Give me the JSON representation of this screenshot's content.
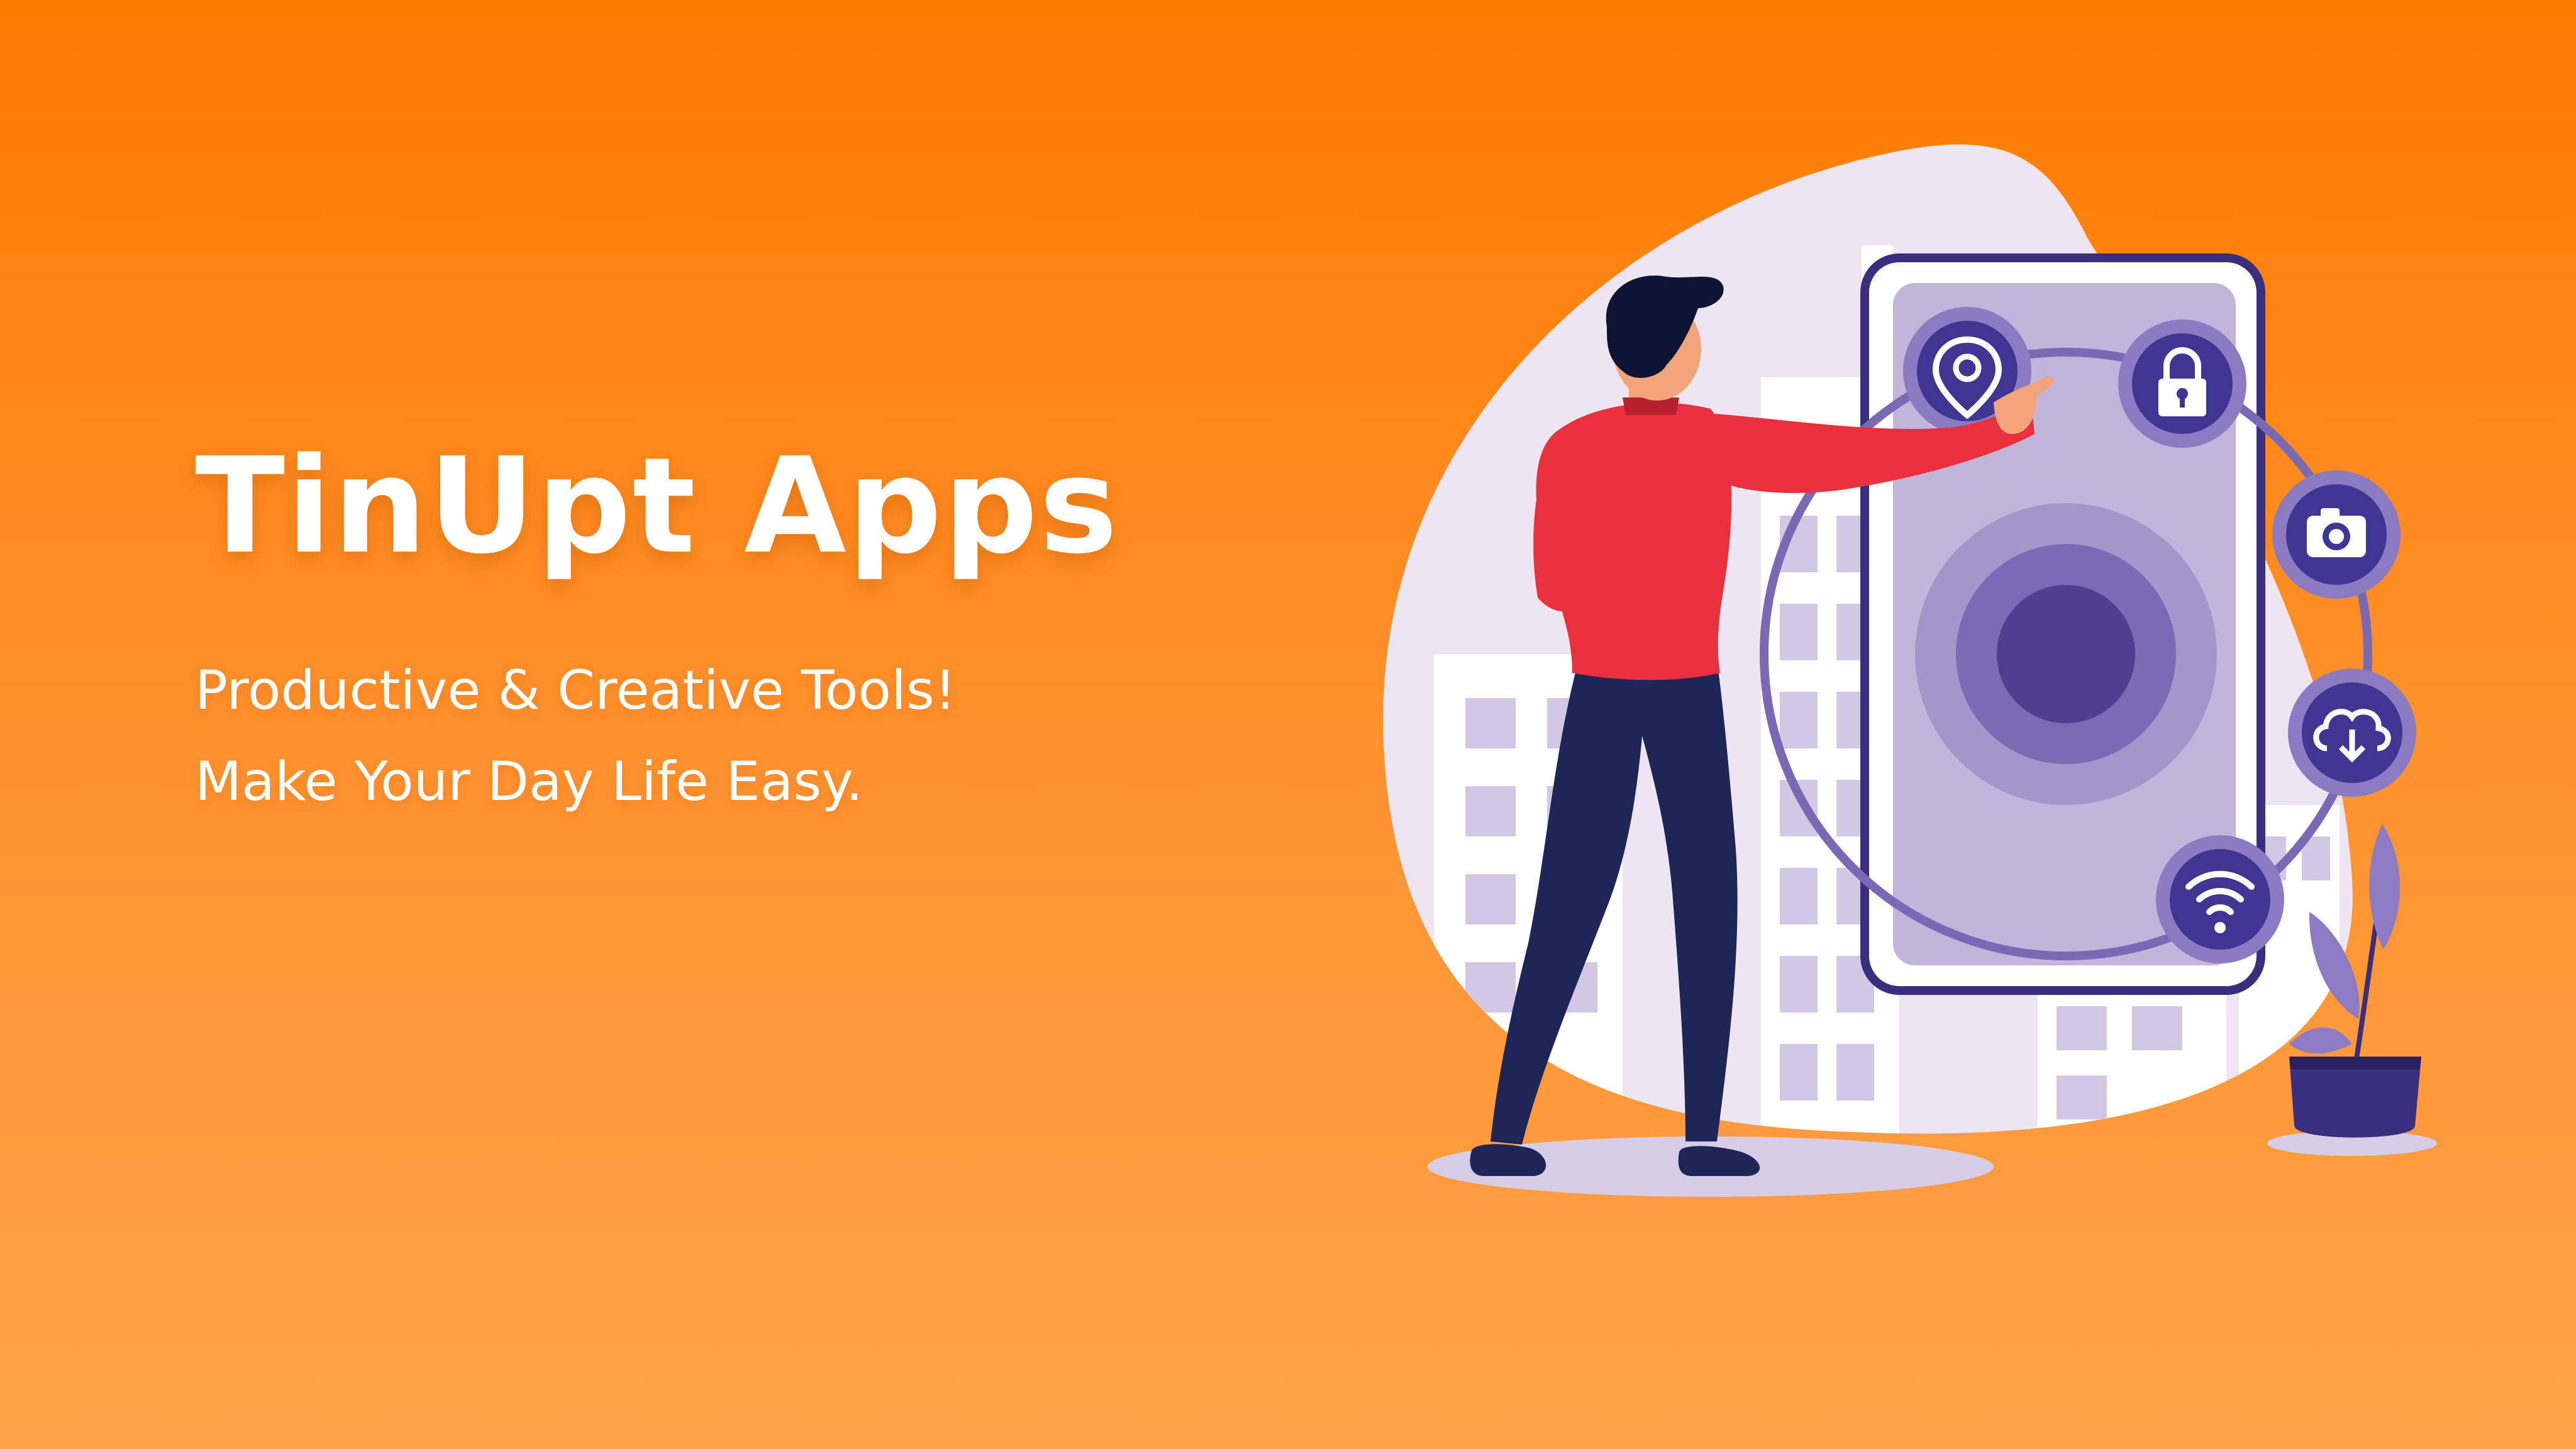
{
  "hero": {
    "title": "TinUpt Apps",
    "tagline_1": "Productive & Creative Tools!",
    "tagline_2": "Make Your Day Life Easy."
  },
  "illustration": {
    "icons": [
      "location-pin-icon",
      "lock-icon",
      "camera-icon",
      "cloud-download-icon",
      "wifi-icon"
    ]
  },
  "colors": {
    "background_top": "#FF7B00",
    "background_bottom": "#FFA34A",
    "blob": "#EDE6F2",
    "building": "#D2C8E3",
    "phone_frame": "#3A2F7E",
    "phone_screen": "#C2B5DA",
    "icon_circle": "#3F3592",
    "shirt": "#E8303F",
    "pants": "#1E2658",
    "plant": "#8D7CC4"
  }
}
